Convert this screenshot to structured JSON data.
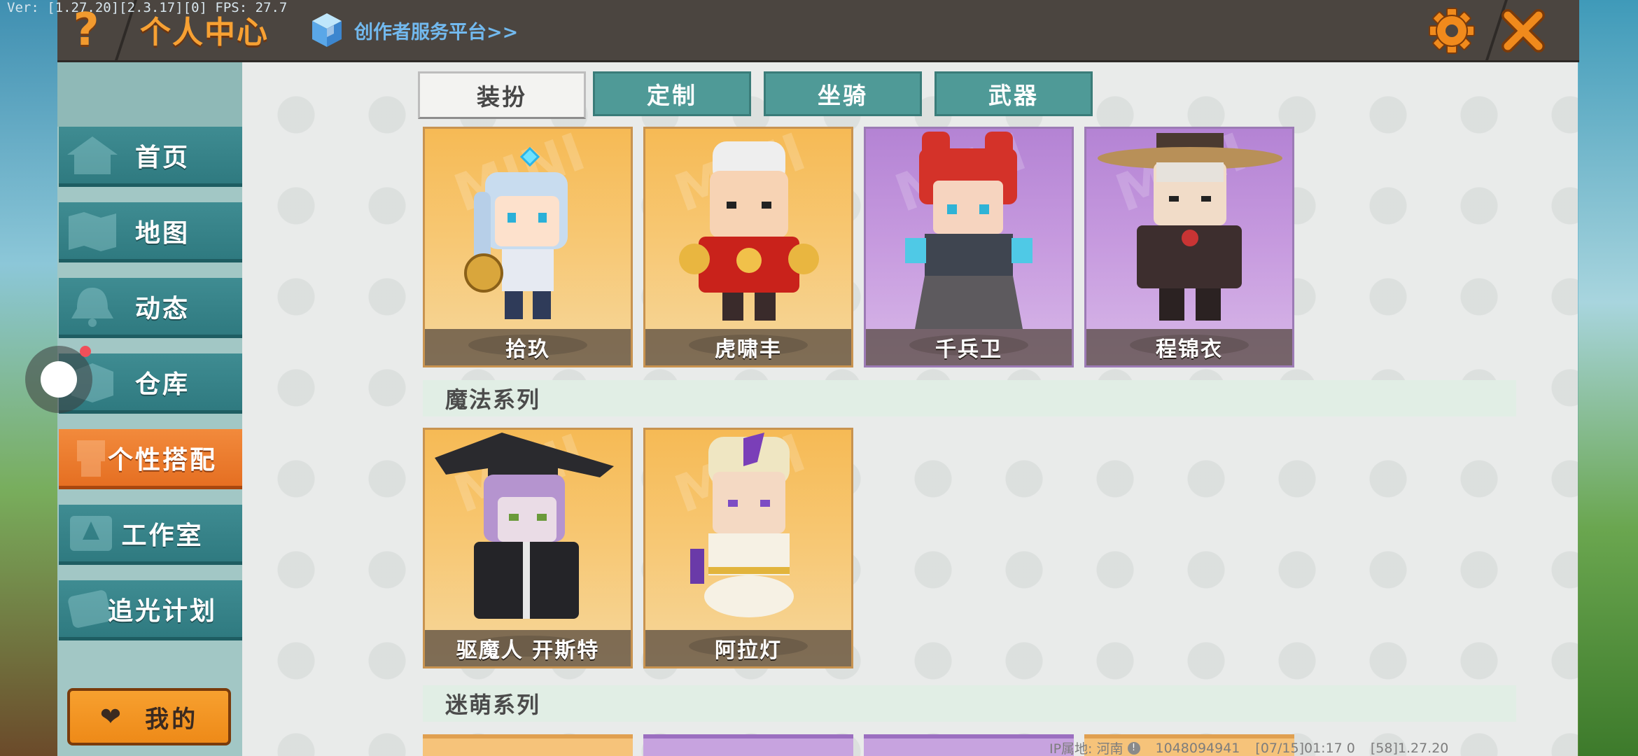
{
  "status_overlay": {
    "version_text": "Ver: [1.27.20][2.3.17][0] FPS: 27.7"
  },
  "header": {
    "help_symbol": "?",
    "title": "个人中心",
    "creator_platform_link": "创作者服务平台>>",
    "icons": {
      "help": "question-mark-icon",
      "creator": "cube-icon",
      "settings": "gear-icon",
      "close": "close-x-icon"
    },
    "accent_color": "#f7a133"
  },
  "sidebar": {
    "items": [
      {
        "label": "首页",
        "icon": "house-icon",
        "active": false
      },
      {
        "label": "地图",
        "icon": "map-icon",
        "active": false
      },
      {
        "label": "动态",
        "icon": "bell-icon",
        "active": false
      },
      {
        "label": "仓库",
        "icon": "box-icon",
        "active": false
      },
      {
        "label": "个性搭配",
        "icon": "character-icon",
        "active": true
      },
      {
        "label": "工作室",
        "icon": "studio-icon",
        "active": false
      },
      {
        "label": "追光计划",
        "icon": "spotlight-icon",
        "active": false
      }
    ],
    "mine_button": {
      "label": "我的",
      "icon": "heart-icon"
    },
    "colors": {
      "item": "#3f8c92",
      "active": "#f28a3c"
    }
  },
  "tabs": [
    {
      "label": "装扮",
      "active": true
    },
    {
      "label": "定制",
      "active": false
    },
    {
      "label": "坐骑",
      "active": false
    },
    {
      "label": "武器",
      "active": false
    }
  ],
  "skins_row1": [
    {
      "name": "拾玖",
      "bg": "gold"
    },
    {
      "name": "虎啸丰",
      "bg": "gold"
    },
    {
      "name": "千兵卫",
      "bg": "purple"
    },
    {
      "name": "程锦衣",
      "bg": "purple"
    }
  ],
  "section_magic": {
    "title": "魔法系列"
  },
  "skins_row2": [
    {
      "name": "驱魔人 开斯特",
      "bg": "gold"
    },
    {
      "name": "阿拉灯",
      "bg": "gold"
    }
  ],
  "section_cute": {
    "title": "迷萌系列"
  },
  "footer": {
    "ip_location": "IP属地: 河南",
    "user_id": "1048094941",
    "timestamp": "[07/15]01:17 0",
    "build": "[58]1.27.20"
  },
  "card_watermark": "MINI"
}
